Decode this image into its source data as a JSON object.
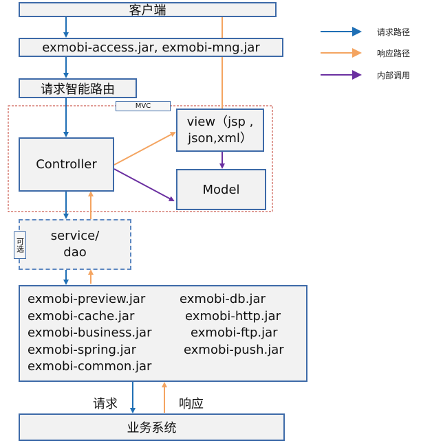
{
  "client": "客户端",
  "access": "exmobi-access.jar, exmobi-mng.jar",
  "router": "请求智能路由",
  "mvc_label": "MVC",
  "controller": "Controller",
  "view": {
    "line1": "view（jsp ,",
    "line2": "json,xml）"
  },
  "model": "Model",
  "optional": "可选",
  "service": {
    "line1": "service/",
    "line2": "dao"
  },
  "jars": {
    "left": [
      "exmobi-preview.jar",
      "exmobi-cache.jar",
      "exmobi-business.jar",
      "exmobi-spring.jar",
      "exmobi-common.jar"
    ],
    "right": [
      "exmobi-db.jar",
      "exmobi-http.jar",
      "exmobi-ftp.jar",
      "exmobi-push.jar"
    ]
  },
  "request_label": "请求",
  "response_label": "响应",
  "business_system": "业务系统",
  "legend": [
    {
      "label": "请求路径",
      "color": "#1f6fb5"
    },
    {
      "label": "响应路径",
      "color": "#f4a460"
    },
    {
      "label": "内部调用",
      "color": "#6a2fa0"
    }
  ]
}
